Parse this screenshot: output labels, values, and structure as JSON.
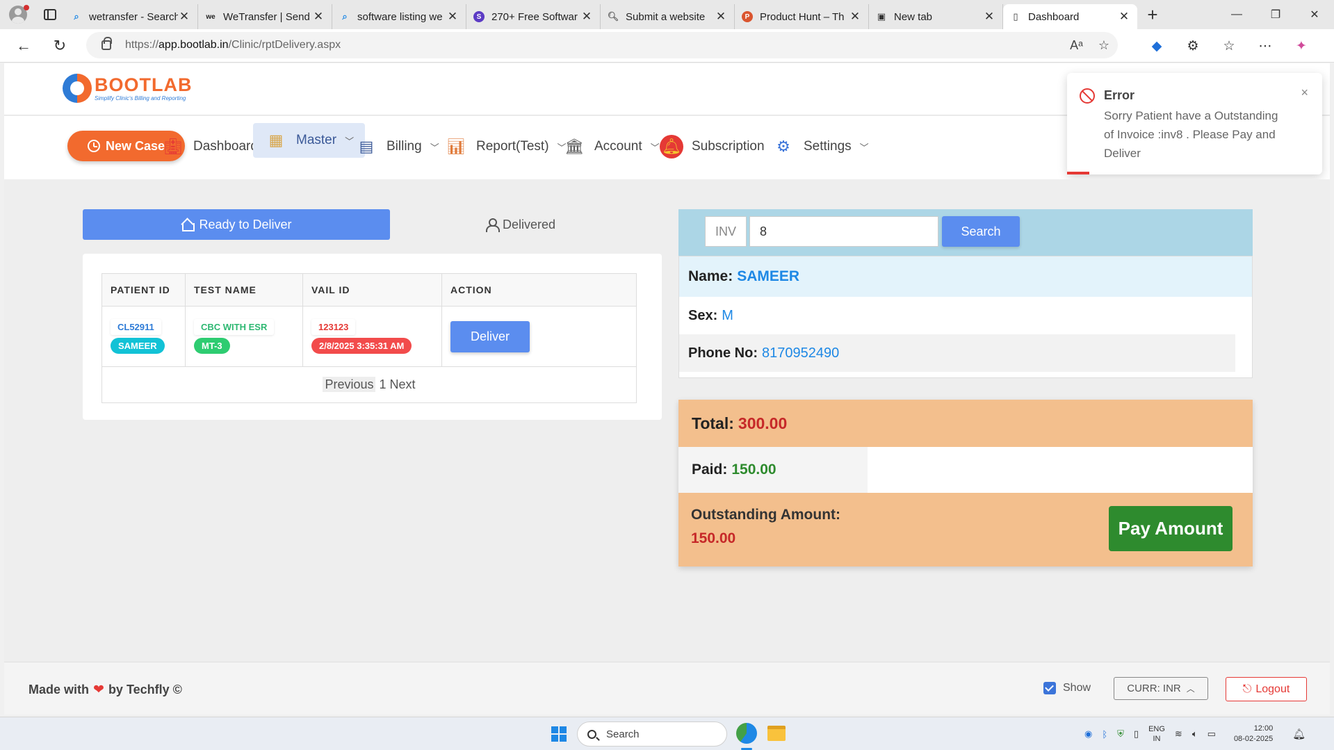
{
  "browser": {
    "tabs": [
      {
        "title": "wetransfer - Search",
        "icon": "search-favicon",
        "color": "#1e88e5"
      },
      {
        "title": "WeTransfer | Send",
        "icon": "wetransfer-favicon",
        "color": "#222222"
      },
      {
        "title": "software listing we",
        "icon": "search-favicon",
        "color": "#1e88e5"
      },
      {
        "title": "270+ Free Softwar",
        "icon": "s-favicon",
        "color": "#5c3bc4"
      },
      {
        "title": "Submit a website",
        "icon": "magnifier-favicon",
        "color": "#666666"
      },
      {
        "title": "Product Hunt – Th",
        "icon": "producthunt-favicon",
        "color": "#da552f"
      },
      {
        "title": "New tab",
        "icon": "newtab-favicon",
        "color": "#333333"
      },
      {
        "title": "Dashboard",
        "icon": "page-favicon",
        "color": "#333333",
        "active": true
      }
    ],
    "url_prefix": "https://",
    "url_host": "app.bootlab.in",
    "url_path": "/Clinic/rptDelivery.aspx"
  },
  "app": {
    "brand": "BOOTLAB",
    "tagline": "Simplify Clinic's Billing and Reporting"
  },
  "nav": {
    "new_case": "New Case",
    "items": [
      {
        "label": "Dashboards",
        "icon": "hospital-icon",
        "chevron": false
      },
      {
        "label": "Master",
        "icon": "master-icon",
        "chevron": true,
        "active": true
      },
      {
        "label": "Billing",
        "icon": "billing-icon",
        "chevron": true
      },
      {
        "label": "Report(Test)",
        "icon": "report-icon",
        "chevron": true
      },
      {
        "label": "Account",
        "icon": "bank-icon",
        "chevron": true
      },
      {
        "label": "Subscription",
        "icon": "bell-icon",
        "chevron": false
      },
      {
        "label": "Settings",
        "icon": "gear-icon",
        "chevron": true
      }
    ]
  },
  "toast": {
    "title": "Error",
    "message": "Sorry Patient have a Outstanding of Invoice :inv8 . Please Pay and Deliver",
    "close": "×"
  },
  "tabs": {
    "ready": "Ready to Deliver",
    "delivered": "Delivered"
  },
  "table": {
    "headers": [
      "PATIENT ID",
      "TEST NAME",
      "VAIL ID",
      "ACTION"
    ],
    "rows": [
      {
        "patient_id": "CL52911",
        "patient_name": "SAMEER",
        "test_name": "CBC WITH ESR",
        "test_code": "MT-3",
        "vail_id": "123123",
        "vail_date": "2/8/2025 3:35:31 AM",
        "action": "Deliver"
      }
    ],
    "pager": {
      "prev": "Previous",
      "page": "1",
      "next": "Next"
    }
  },
  "search": {
    "prefix": "INV",
    "value": "8",
    "button": "Search"
  },
  "patient": {
    "name_label": "Name:",
    "name": "SAMEER",
    "sex_label": "Sex:",
    "sex": "M",
    "phone_label": "Phone No:",
    "phone": "8170952490"
  },
  "amounts": {
    "total_label": "Total:",
    "total": "300.00",
    "paid_label": "Paid:",
    "paid": "150.00",
    "outstanding_label": "Outstanding Amount:",
    "outstanding": "150.00",
    "pay_button": "Pay Amount"
  },
  "footer": {
    "made_prefix": "Made with",
    "made_suffix": "by Techfly ©",
    "show": "Show",
    "currency": "CURR: INR",
    "logout": "Logout"
  },
  "taskbar": {
    "search": "Search",
    "lang_line1": "ENG",
    "lang_line2": "IN",
    "time": "12:00",
    "date": "08-02-2025"
  },
  "colors": {
    "brand_orange": "#f26a2e",
    "primary_blue": "#5b8def",
    "pay_green": "#2e8b2e",
    "amount_bg": "#f3bf8d",
    "error_red": "#e53935"
  }
}
